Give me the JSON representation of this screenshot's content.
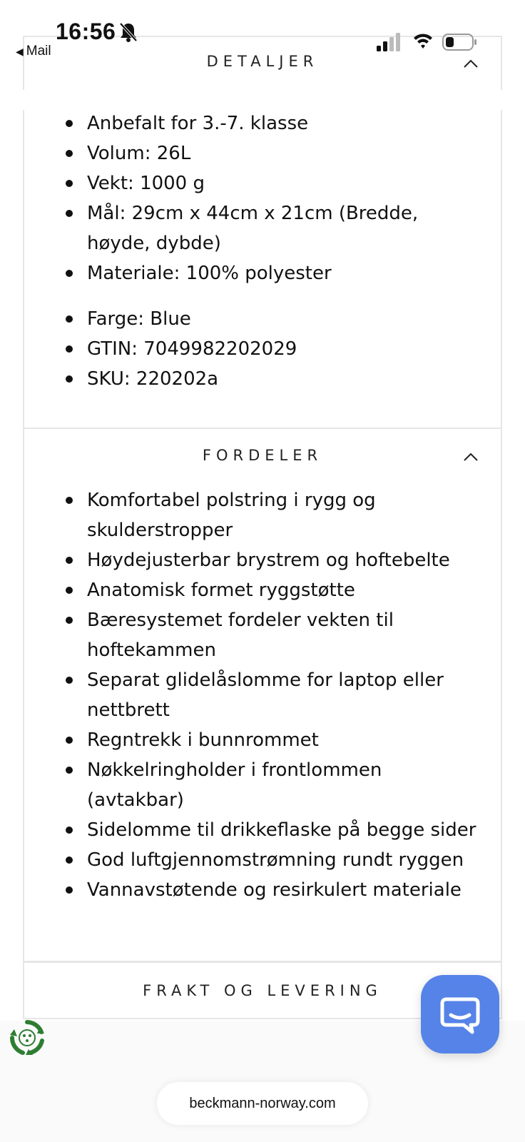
{
  "status_bar": {
    "time": "16:56",
    "back_label": "Mail",
    "icons": [
      "bell-mute-icon",
      "cellular-signal-icon",
      "wifi-icon",
      "battery-icon"
    ]
  },
  "detaljer": {
    "title": "DETALJER",
    "items_a": [
      "Anbefalt for 3.-7. klasse",
      "Volum: 26L",
      "Vekt: 1000 g",
      "Mål: 29cm x 44cm x 21cm (Bredde, høyde, dybde)",
      "Materiale: 100% polyester"
    ],
    "items_b": [
      "Farge: Blue",
      "GTIN: 7049982202029",
      "SKU: 220202a"
    ]
  },
  "fordeler": {
    "title": "FORDELER",
    "items": [
      "Komfortabel polstring i rygg og skulderstropper",
      "Høydejusterbar brystrem og hoftebelte",
      "Anatomisk formet ryggstøtte",
      "Bæresystemet fordeler vekten til hoftekammen",
      "Separat glidelåslomme for laptop eller nettbrett",
      "Regntrekk i bunnrommet",
      "Nøkkelringholder i frontlommen (avtakbar)",
      "Sidelomme til drikkeflaske på begge sider",
      "God luftgjennomstrømning rundt ryggen",
      "Vannavstøtende og resirkulert materiale"
    ]
  },
  "frakt": {
    "title": "FRAKT OG LEVERING"
  },
  "url": "beckmann-norway.com",
  "colors": {
    "chat_button": "#5583e8",
    "eco_badge": "#2e7d32",
    "border": "#e6e6e6"
  }
}
